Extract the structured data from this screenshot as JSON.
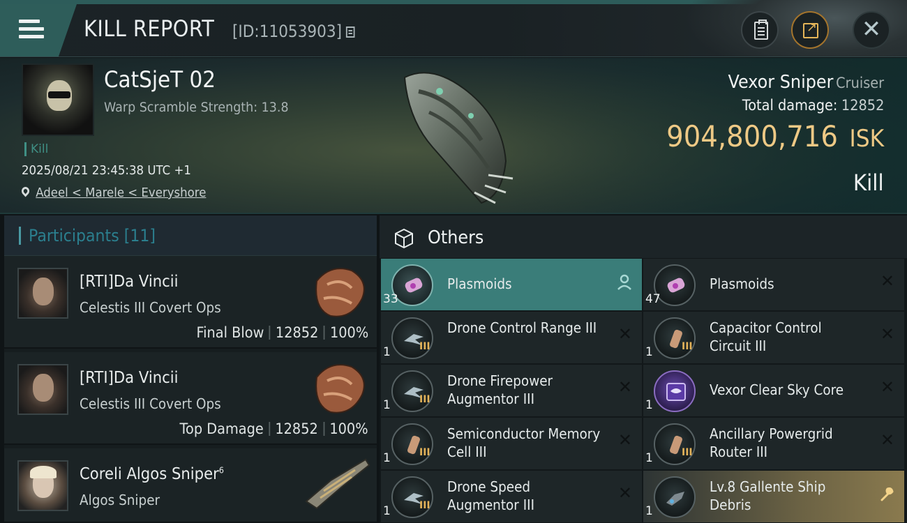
{
  "header": {
    "title": "KILL REPORT",
    "report_id": "[ID:11053903]"
  },
  "victim": {
    "name": "CatSjeT 02",
    "subtitle": "Warp Scramble Strength: 13.8",
    "tag": "Kill",
    "datetime": "2025/08/21 23:45:38 UTC +1",
    "location": "Adeel < Marele < Everyshore",
    "ship_name": "Vexor Sniper",
    "ship_class": "Cruiser",
    "total_damage_label": "Total damage:",
    "total_damage": "12852",
    "isk_value": "904,800,716",
    "isk_unit": "ISK",
    "result": "Kill"
  },
  "participants": {
    "title": "Participants [11]",
    "items": [
      {
        "name": "[RTI]Da Vincii",
        "sup": "",
        "ship": "Celestis III Covert Ops",
        "role": "Final Blow",
        "damage": "12852",
        "percent": "100%"
      },
      {
        "name": "[RTI]Da Vincii",
        "sup": "",
        "ship": "Celestis III Covert Ops",
        "role": "Top Damage",
        "damage": "12852",
        "percent": "100%"
      },
      {
        "name": "Coreli Algos Sniper",
        "sup": "6",
        "ship": "Algos Sniper",
        "role": "",
        "damage": "",
        "percent": ""
      }
    ]
  },
  "others": {
    "title": "Others",
    "items": [
      {
        "name": "Plasmoids",
        "qty": "33",
        "tier": "",
        "icon": "plasmoid-canister-icon",
        "action": "person-icon"
      },
      {
        "name": "Plasmoids",
        "qty": "47",
        "tier": "",
        "icon": "plasmoid-canister-icon",
        "action": "close-icon"
      },
      {
        "name": "Drone Control Range III",
        "qty": "1",
        "tier": "III",
        "icon": "drone-module-icon",
        "action": "close-icon"
      },
      {
        "name": "Capacitor Control Circuit III",
        "qty": "1",
        "tier": "III",
        "icon": "rig-cylinder-icon",
        "action": "close-icon"
      },
      {
        "name": "Drone Firepower Augmentor III",
        "qty": "1",
        "tier": "III",
        "icon": "drone-module-icon",
        "action": "close-icon"
      },
      {
        "name": "Vexor Clear Sky Core",
        "qty": "1",
        "tier": "",
        "icon": "core-chip-icon",
        "action": "close-icon"
      },
      {
        "name": "Semiconductor Memory Cell III",
        "qty": "1",
        "tier": "III",
        "icon": "rig-cylinder-icon",
        "action": "close-icon"
      },
      {
        "name": "Ancillary Powergrid Router III",
        "qty": "1",
        "tier": "III",
        "icon": "rig-cylinder-icon",
        "action": "close-icon"
      },
      {
        "name": "Drone Speed Augmentor III",
        "qty": "1",
        "tier": "III",
        "icon": "drone-module-icon",
        "action": "close-icon"
      },
      {
        "name": "Lv.8 Gallente Ship Debris",
        "qty": "1",
        "tier": "",
        "icon": "ship-debris-icon",
        "action": "wrench-icon"
      }
    ]
  },
  "colors": {
    "accent_teal": "#3a7d79",
    "isk_gold": "#eec985",
    "tier_gold": "#e4b35a"
  }
}
